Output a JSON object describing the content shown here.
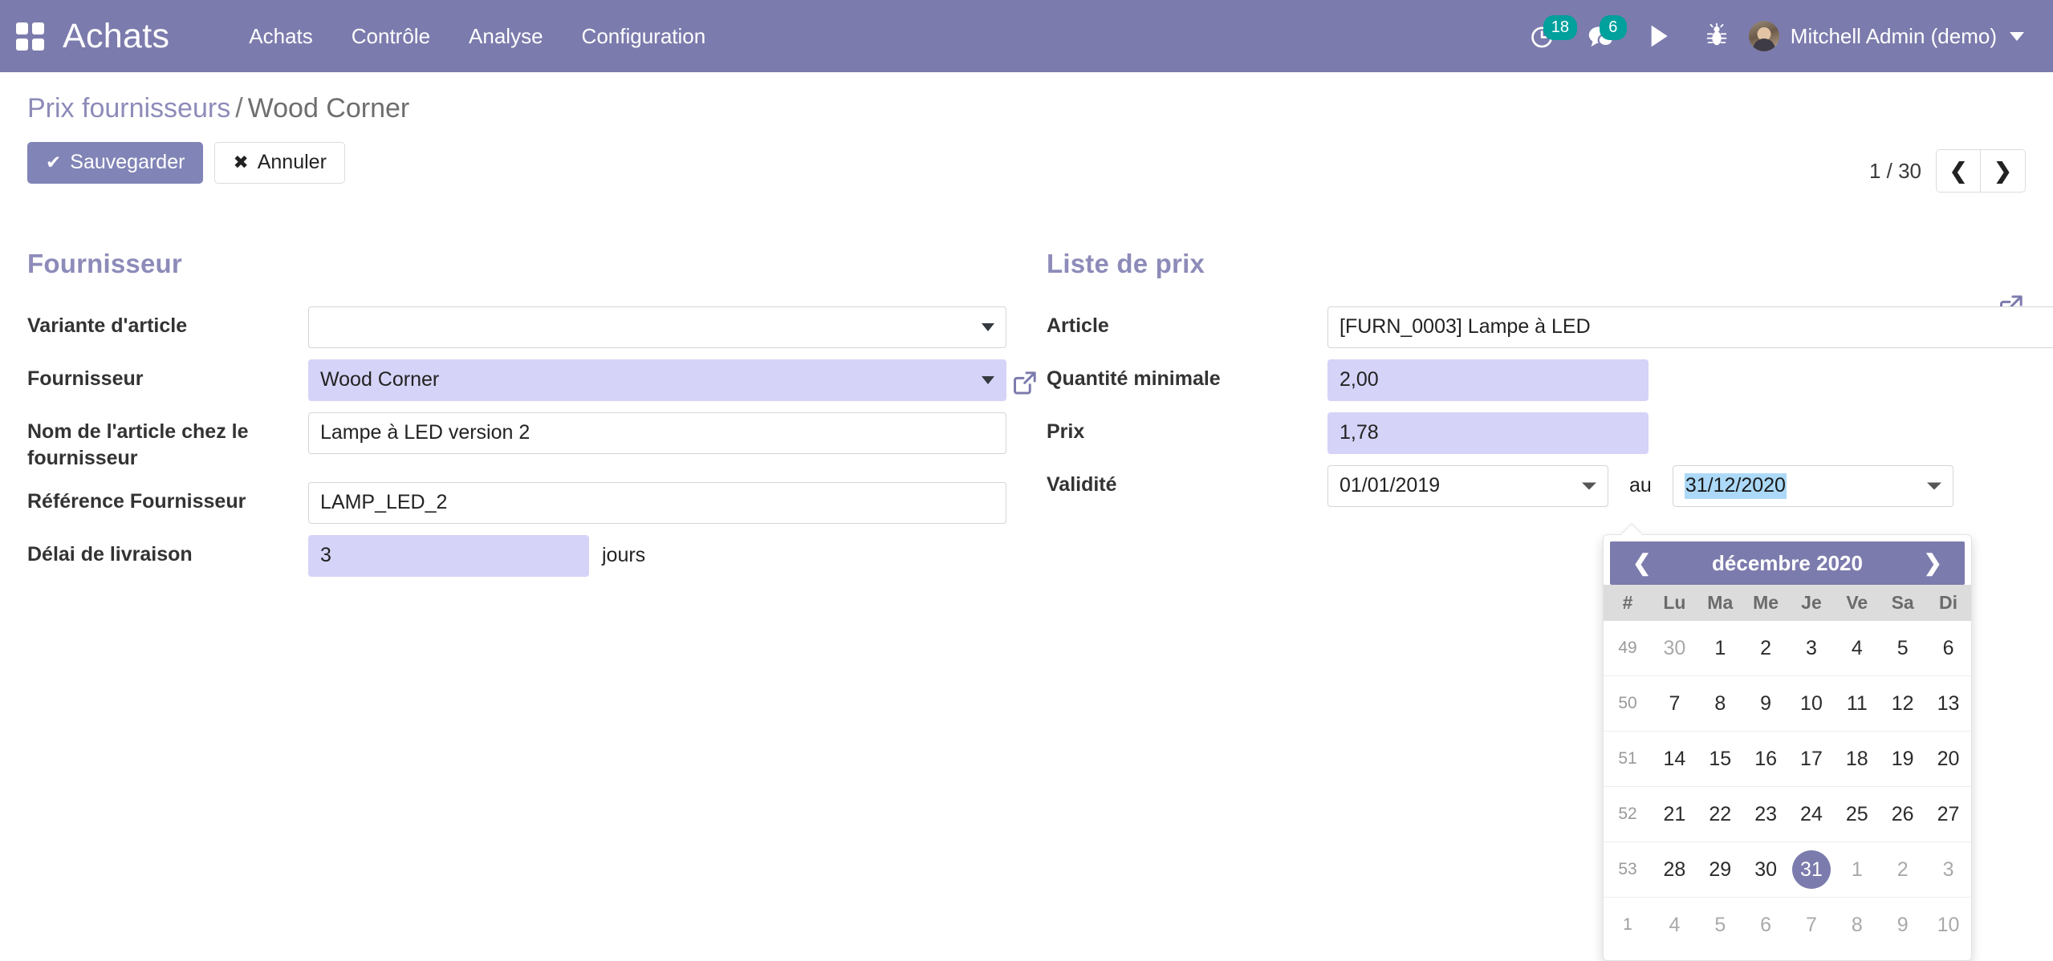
{
  "navbar": {
    "apps_icon": "apps-grid-icon",
    "brand": "Achats",
    "menu": [
      {
        "label": "Achats"
      },
      {
        "label": "Contrôle"
      },
      {
        "label": "Analyse"
      },
      {
        "label": "Configuration"
      }
    ],
    "activities": {
      "icon": "clock-icon",
      "count": "18"
    },
    "messages": {
      "icon": "chat-bubble-icon",
      "count": "6"
    },
    "run": {
      "icon": "play-icon"
    },
    "debug": {
      "icon": "bug-icon"
    },
    "user": {
      "name": "Mitchell Admin (demo)",
      "avatar": "user-avatar"
    },
    "accent_color": "#7C7BAD",
    "badge_color": "#00A09D"
  },
  "control_panel": {
    "breadcrumb": {
      "root": "Prix fournisseurs",
      "separator": "/",
      "current": "Wood Corner"
    },
    "save_label": "Sauvegarder",
    "save_icon": "✔",
    "discard_label": "Annuler",
    "discard_icon": "✖",
    "pager": {
      "count": "1 / 30",
      "prev_icon": "❮",
      "next_icon": "❯"
    }
  },
  "form": {
    "left_group": {
      "title": "Fournisseur",
      "fields": {
        "product_variant": {
          "label": "Variante d'article",
          "value": "",
          "placeholder": ""
        },
        "vendor": {
          "label": "Fournisseur",
          "value": "Wood Corner"
        },
        "product_name": {
          "label": "Nom de l'article chez le fournisseur",
          "value": "Lampe à LED version 2"
        },
        "product_code": {
          "label": "Référence Fournisseur",
          "value": "LAMP_LED_2"
        },
        "delivery_lead_time": {
          "label": "Délai de livraison",
          "value": "3",
          "suffix": "jours"
        }
      }
    },
    "right_group": {
      "title": "Liste de prix",
      "fields": {
        "product": {
          "label": "Article",
          "value": "[FURN_0003] Lampe à LED"
        },
        "min_qty": {
          "label": "Quantité minimale",
          "value": "2,00",
          "icon": "external-link-icon"
        },
        "price": {
          "label": "Prix",
          "value": "1,78"
        },
        "validity": {
          "label": "Validité",
          "date_from": "01/01/2019",
          "between_label": "au",
          "date_to": "31/12/2020"
        }
      },
      "open_record_icon": "external-link-icon"
    },
    "dirty_field_color": "#D5D3F7",
    "group_title_color": "#8D8BB9"
  },
  "datepicker": {
    "prev_icon": "❮",
    "next_icon": "❯",
    "title": "décembre 2020",
    "week_header": "#",
    "day_headers": [
      "Lu",
      "Ma",
      "Me",
      "Je",
      "Ve",
      "Sa",
      "Di"
    ],
    "selected_day": "31",
    "weeks": [
      {
        "week": "49",
        "days": [
          {
            "d": "30",
            "state": "old"
          },
          {
            "d": "1",
            "state": "cur"
          },
          {
            "d": "2",
            "state": "cur"
          },
          {
            "d": "3",
            "state": "cur"
          },
          {
            "d": "4",
            "state": "cur"
          },
          {
            "d": "5",
            "state": "cur"
          },
          {
            "d": "6",
            "state": "cur"
          }
        ]
      },
      {
        "week": "50",
        "days": [
          {
            "d": "7",
            "state": "cur"
          },
          {
            "d": "8",
            "state": "cur"
          },
          {
            "d": "9",
            "state": "cur"
          },
          {
            "d": "10",
            "state": "cur"
          },
          {
            "d": "11",
            "state": "cur"
          },
          {
            "d": "12",
            "state": "cur"
          },
          {
            "d": "13",
            "state": "cur"
          }
        ]
      },
      {
        "week": "51",
        "days": [
          {
            "d": "14",
            "state": "cur"
          },
          {
            "d": "15",
            "state": "cur"
          },
          {
            "d": "16",
            "state": "cur"
          },
          {
            "d": "17",
            "state": "cur"
          },
          {
            "d": "18",
            "state": "cur"
          },
          {
            "d": "19",
            "state": "cur"
          },
          {
            "d": "20",
            "state": "cur"
          }
        ]
      },
      {
        "week": "52",
        "days": [
          {
            "d": "21",
            "state": "cur"
          },
          {
            "d": "22",
            "state": "cur"
          },
          {
            "d": "23",
            "state": "cur"
          },
          {
            "d": "24",
            "state": "cur"
          },
          {
            "d": "25",
            "state": "cur"
          },
          {
            "d": "26",
            "state": "cur"
          },
          {
            "d": "27",
            "state": "cur"
          }
        ]
      },
      {
        "week": "53",
        "days": [
          {
            "d": "28",
            "state": "cur"
          },
          {
            "d": "29",
            "state": "cur"
          },
          {
            "d": "30",
            "state": "cur"
          },
          {
            "d": "31",
            "state": "active"
          },
          {
            "d": "1",
            "state": "new"
          },
          {
            "d": "2",
            "state": "new"
          },
          {
            "d": "3",
            "state": "new"
          }
        ]
      },
      {
        "week": "1",
        "days": [
          {
            "d": "4",
            "state": "new"
          },
          {
            "d": "5",
            "state": "new"
          },
          {
            "d": "6",
            "state": "new"
          },
          {
            "d": "7",
            "state": "new"
          },
          {
            "d": "8",
            "state": "new"
          },
          {
            "d": "9",
            "state": "new"
          },
          {
            "d": "10",
            "state": "new"
          }
        ]
      }
    ],
    "header_color": "#7C7BAD"
  }
}
